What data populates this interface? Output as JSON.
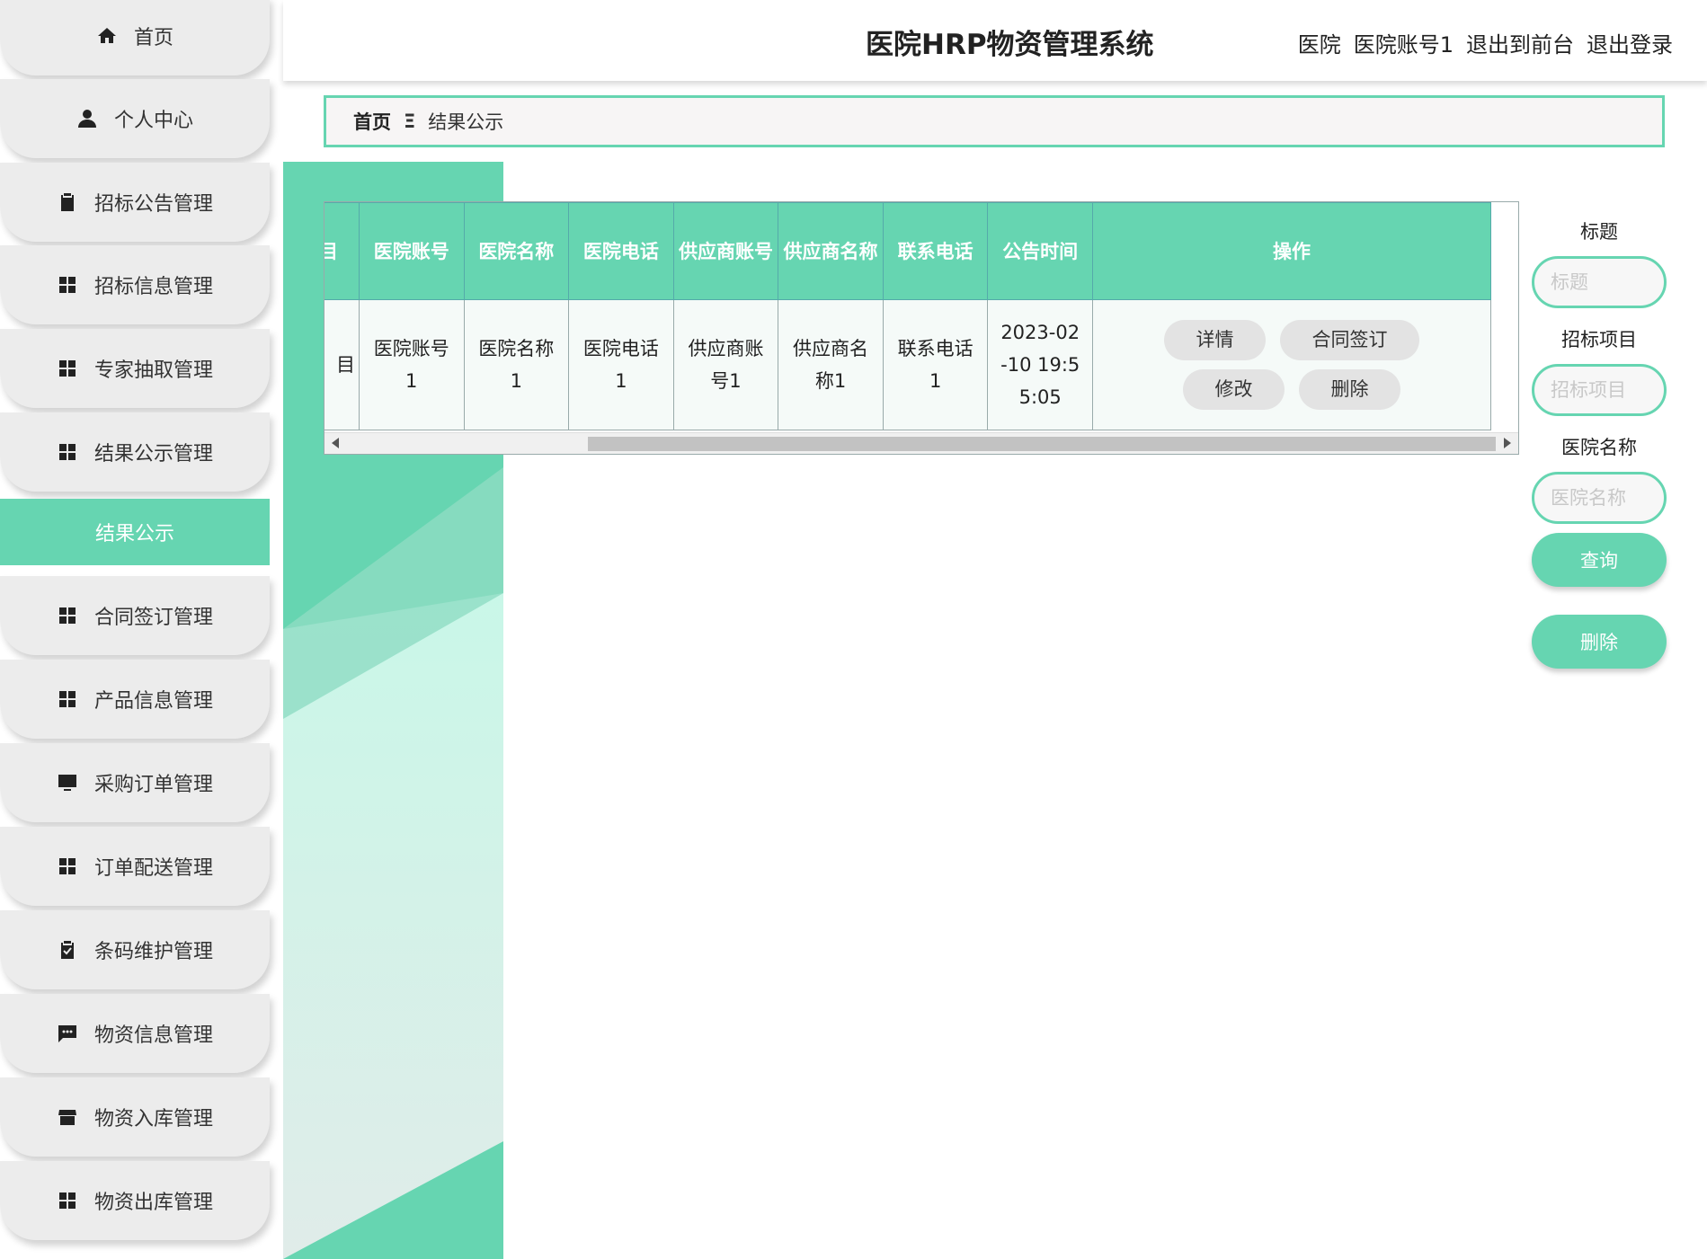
{
  "app_title": "医院HRP物资管理系统",
  "user": {
    "role": "医院",
    "account": "医院账号1",
    "to_front": "退出到前台",
    "logout": "退出登录"
  },
  "sidebar": {
    "items": [
      {
        "label": "首页",
        "icon": "home-icon"
      },
      {
        "label": "个人中心",
        "icon": "person-icon"
      },
      {
        "label": "招标公告管理",
        "icon": "clipboard-icon"
      },
      {
        "label": "招标信息管理",
        "icon": "grid-icon"
      },
      {
        "label": "专家抽取管理",
        "icon": "grid-icon"
      },
      {
        "label": "结果公示管理",
        "icon": "grid-icon"
      },
      {
        "label": "合同签订管理",
        "icon": "grid-icon"
      },
      {
        "label": "产品信息管理",
        "icon": "grid-icon"
      },
      {
        "label": "采购订单管理",
        "icon": "monitor-icon"
      },
      {
        "label": "订单配送管理",
        "icon": "grid-icon"
      },
      {
        "label": "条码维护管理",
        "icon": "clipboard-check-icon"
      },
      {
        "label": "物资信息管理",
        "icon": "chat-icon"
      },
      {
        "label": "物资入库管理",
        "icon": "store-icon"
      },
      {
        "label": "物资出库管理",
        "icon": "grid-icon"
      }
    ],
    "active_sub": "结果公示"
  },
  "breadcrumb": {
    "home": "首页",
    "separator": "Ξ",
    "current": "结果公示"
  },
  "table": {
    "headers": [
      "目",
      "医院账号",
      "医院名称",
      "医院电话",
      "供应商账号",
      "供应商名称",
      "联系电话",
      "公告时间",
      "操作"
    ],
    "rows": [
      {
        "cells": [
          "目",
          "医院账号1",
          "医院名称1",
          "医院电话1",
          "供应商账号1",
          "供应商名称1",
          "联系电话1",
          "2023-02-10 19:55:05"
        ],
        "actions": [
          "详情",
          "合同签订",
          "修改",
          "删除"
        ]
      }
    ]
  },
  "search": {
    "title_label": "标题",
    "title_placeholder": "标题",
    "project_label": "招标项目",
    "project_placeholder": "招标项目",
    "hospital_label": "医院名称",
    "hospital_placeholder": "医院名称",
    "query_button": "查询",
    "delete_button": "删除"
  },
  "colors": {
    "accent": "#66d5b1",
    "nav_bg": "#ececec"
  }
}
